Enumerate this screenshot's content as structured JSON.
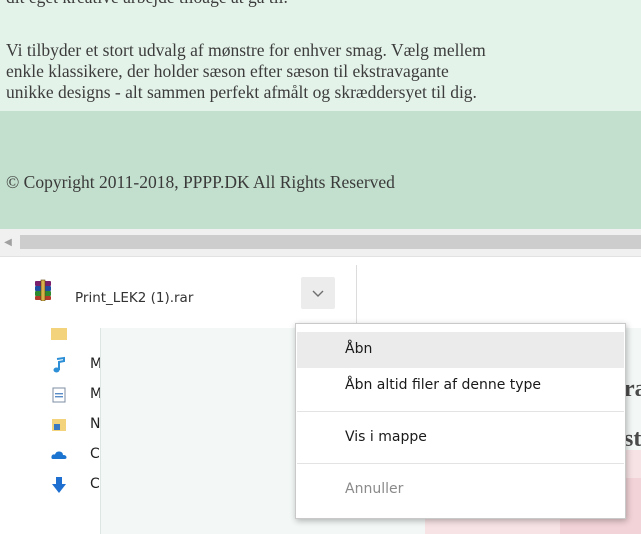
{
  "webpage": {
    "top_text": "dit eget kreative arbejde tiloage at gå til.",
    "paragraph_lines": [
      "Vi tilbyder et stort udvalg af mønstre for enhver smag. Vælg mellem",
      "enkle klassikere, der holder sæson efter sæson til ekstravagante",
      "unikke designs - alt sammen perfekt afmålt og skræddersyet til dig."
    ],
    "copyright": "© Copyright 2011-2018, PPPP.DK All Rights Reserved"
  },
  "scrollbar": {
    "left_arrow": "◀"
  },
  "download_bar": {
    "filename": "Print_LEK2 (1).rar",
    "file_icon": "winrar-archive-icon",
    "menu_button_icon": "chevron-down-icon"
  },
  "background_window": {
    "tree_items": [
      {
        "icon": "music-note-icon",
        "label": "M"
      },
      {
        "icon": "document-icon",
        "label": "M"
      },
      {
        "icon": "picture-icon",
        "label": "N"
      },
      {
        "icon": "cloud-icon",
        "label": "C"
      },
      {
        "icon": "download-arrow-icon",
        "label": "C"
      }
    ],
    "big_text": [
      "ra",
      "st"
    ]
  },
  "context_menu": {
    "items": [
      {
        "label": "Åbn",
        "enabled": true,
        "highlighted": true
      },
      {
        "label": "Åbn altid filer af denne type",
        "enabled": true,
        "highlighted": false
      },
      {
        "label": "Vis i mappe",
        "enabled": true,
        "highlighted": false
      },
      {
        "label": "Annuller",
        "enabled": false,
        "highlighted": false
      }
    ]
  },
  "colors": {
    "page_background": "#e4f3ea",
    "footer_background": "#c3dfcd",
    "menu_highlight": "#ebebeb",
    "disabled_text": "#8a8a8a"
  }
}
